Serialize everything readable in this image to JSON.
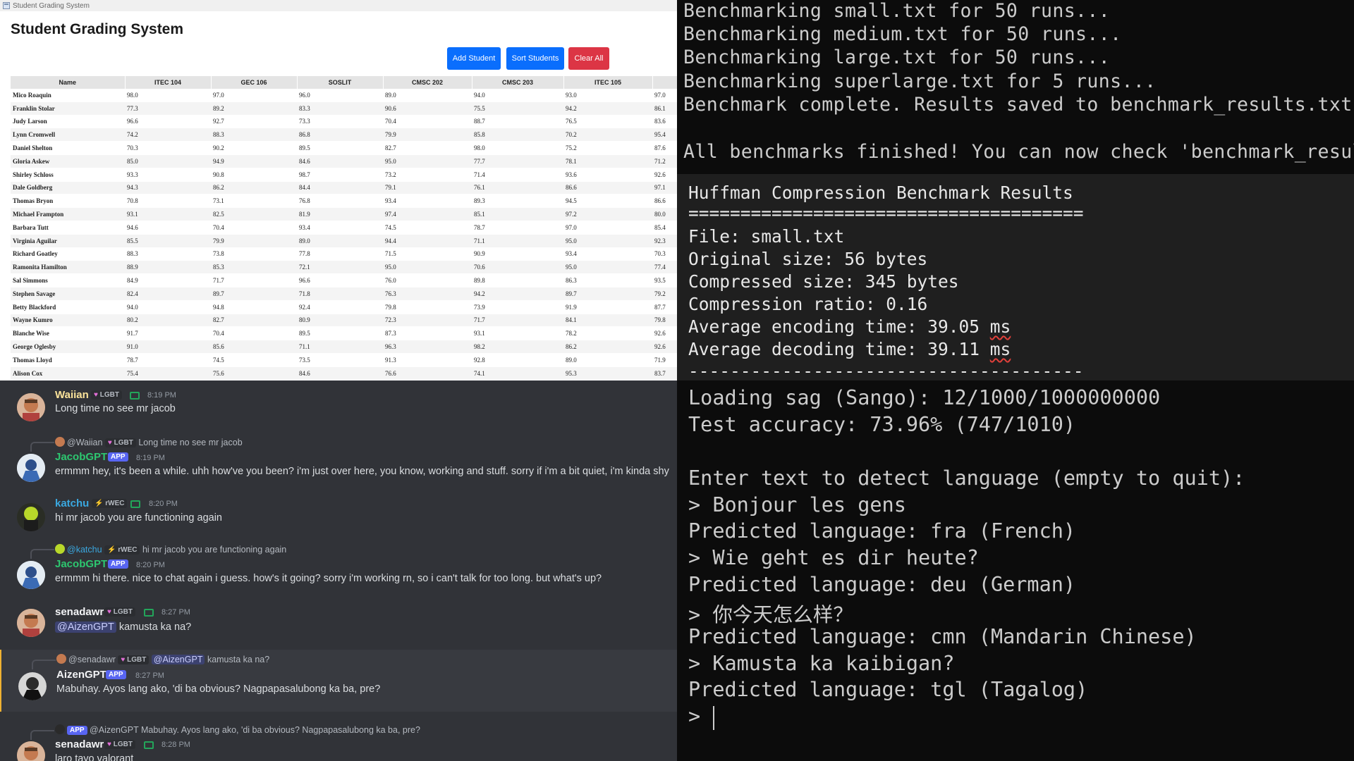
{
  "grading": {
    "window_title": "Student Grading System",
    "heading": "Student Grading System",
    "buttons": {
      "add": "Add Student",
      "sort": "Sort Students",
      "clear": "Clear All"
    },
    "columns": [
      "Name",
      "ITEC 104",
      "GEC 106",
      "SOSLIT",
      "CMSC 202",
      "CMSC 203",
      "ITEC 105",
      ""
    ],
    "rows": [
      [
        "Mico Roaquin",
        "98.0",
        "97.0",
        "96.0",
        "89.0",
        "94.0",
        "93.0",
        "97.0"
      ],
      [
        "Franklin Stolar",
        "77.3",
        "89.2",
        "83.3",
        "90.6",
        "75.5",
        "94.2",
        "86.1"
      ],
      [
        "Judy Larson",
        "96.6",
        "92.7",
        "73.3",
        "70.4",
        "88.7",
        "76.5",
        "83.6"
      ],
      [
        "Lynn Cromwell",
        "74.2",
        "88.3",
        "86.8",
        "79.9",
        "85.8",
        "70.2",
        "95.4"
      ],
      [
        "Daniel Shelton",
        "70.3",
        "90.2",
        "89.5",
        "82.7",
        "98.0",
        "75.2",
        "87.6"
      ],
      [
        "Gloria Askew",
        "85.0",
        "94.9",
        "84.6",
        "95.0",
        "77.7",
        "78.1",
        "71.2"
      ],
      [
        "Shirley Schloss",
        "93.3",
        "90.8",
        "98.7",
        "73.2",
        "71.4",
        "93.6",
        "92.6"
      ],
      [
        "Dale Goldberg",
        "94.3",
        "86.2",
        "84.4",
        "79.1",
        "76.1",
        "86.6",
        "97.1"
      ],
      [
        "Thomas Bryon",
        "70.8",
        "73.1",
        "76.8",
        "93.4",
        "89.3",
        "94.5",
        "86.6"
      ],
      [
        "Michael Frampton",
        "93.1",
        "82.5",
        "81.9",
        "97.4",
        "85.1",
        "97.2",
        "80.0"
      ],
      [
        "Barbara Tutt",
        "94.6",
        "70.4",
        "93.4",
        "74.5",
        "78.7",
        "97.0",
        "85.4"
      ],
      [
        "Virginia Aguilar",
        "85.5",
        "79.9",
        "89.0",
        "94.4",
        "71.1",
        "95.0",
        "92.3"
      ],
      [
        "Richard Goatley",
        "88.3",
        "73.8",
        "77.8",
        "71.5",
        "90.9",
        "93.4",
        "70.3"
      ],
      [
        "Ramonita Hamilton",
        "88.9",
        "85.3",
        "72.1",
        "95.0",
        "70.6",
        "95.0",
        "77.4"
      ],
      [
        "Sal Simmons",
        "84.9",
        "71.7",
        "96.6",
        "76.0",
        "89.8",
        "86.3",
        "93.5"
      ],
      [
        "Stephen Savage",
        "82.4",
        "89.7",
        "71.8",
        "76.3",
        "94.2",
        "89.7",
        "79.2"
      ],
      [
        "Betty Blackford",
        "94.0",
        "94.8",
        "92.4",
        "79.8",
        "73.9",
        "91.9",
        "87.7"
      ],
      [
        "Wayne Kumro",
        "80.2",
        "82.7",
        "80.9",
        "72.3",
        "71.7",
        "84.1",
        "79.8"
      ],
      [
        "Blanche Wise",
        "91.7",
        "70.4",
        "89.5",
        "87.3",
        "93.1",
        "78.2",
        "92.6"
      ],
      [
        "George Oglesby",
        "91.0",
        "85.6",
        "71.1",
        "96.3",
        "98.2",
        "86.2",
        "92.6"
      ],
      [
        "Thomas Lloyd",
        "78.7",
        "74.5",
        "73.5",
        "91.3",
        "92.8",
        "89.0",
        "71.9"
      ],
      [
        "Alison Cox",
        "75.4",
        "75.6",
        "84.6",
        "76.6",
        "74.1",
        "95.3",
        "83.7"
      ]
    ]
  },
  "terminal_top": {
    "lines": [
      "Benchmarking small.txt for 50 runs...",
      "Benchmarking medium.txt for 50 runs...",
      "Benchmarking large.txt for 50 runs...",
      "Benchmarking superlarge.txt for 5 runs...",
      "Benchmark complete. Results saved to benchmark_results.txt",
      "All benchmarks finished! You can now check 'benchmark_result"
    ]
  },
  "benchmark": {
    "title": "Huffman Compression Benchmark Results",
    "rule": "======================================",
    "file": "File: small.txt",
    "original": "Original size: 56 bytes",
    "compressed": "Compressed size: 345 bytes",
    "ratio": "Compression ratio: 0.16",
    "enc_prefix": "Average encoding time: 39.05 ",
    "dec_prefix": "Average decoding time: 39.11 ",
    "unit": "ms",
    "dash": "--------------------------------------"
  },
  "chat": {
    "messages": [
      {
        "user": "Waiian",
        "tag": "LGBT",
        "time": "8:19 PM",
        "text": "Long time no see mr jacob"
      },
      {
        "reply_user": "@Waiian",
        "reply_tag": "LGBT",
        "reply_text": "Long time no see mr jacob",
        "user": "JacobGPT",
        "app": "APP",
        "time": "8:19 PM",
        "text": "ermmm hey, it's been a while. uhh how've you been? i'm just over here, you know, working and stuff. sorry if i'm a bit quiet, i'm kinda shy"
      },
      {
        "user": "katchu",
        "tag": "rWEC",
        "time": "8:20 PM",
        "text": "hi mr jacob you are functioning again"
      },
      {
        "reply_user": "@katchu",
        "reply_tag": "rWEC",
        "reply_text": "hi mr jacob you are functioning again",
        "user": "JacobGPT",
        "app": "APP",
        "time": "8:20 PM",
        "text": "ermmm hi there. nice to chat again i guess. how's it going? sorry i'm working rn, so i can't talk for too long. but what's up?"
      },
      {
        "user": "senadawr",
        "tag": "LGBT",
        "time": "8:27 PM",
        "mention": "@AizenGPT",
        "text": "kamusta ka na?"
      },
      {
        "reply_user": "@senadawr",
        "reply_tag": "LGBT",
        "reply_mention": "@AizenGPT",
        "reply_text": "kamusta ka na?",
        "user": "AizenGPT",
        "app": "APP",
        "time": "8:27 PM",
        "text": "Mabuhay. Ayos lang ako, 'di ba obvious? Nagpapasalubong ka ba, pre?"
      },
      {
        "reply_app": "APP",
        "reply_user": "@AizenGPT",
        "reply_text": "Mabuhay. Ayos lang ako, 'di ba obvious? Nagpapasalubong ka ba, pre?",
        "user": "senadawr",
        "tag": "LGBT",
        "time": "8:28 PM",
        "text": "laro tayo valorant"
      }
    ]
  },
  "terminal_bottom": {
    "lines": [
      "Loading sag (Sango): 12/1000/1000000000",
      "Test accuracy: 73.96% (747/1010)",
      "",
      "Enter text to detect language (empty to quit):",
      "> Bonjour les gens",
      "Predicted language: fra (French)",
      "> Wie geht es dir heute?",
      "Predicted language: deu (German)",
      "> 你今天怎么样？",
      "Predicted language: cmn (Mandarin Chinese)",
      "> Kamusta ka kaibigan?",
      "Predicted language: tgl (Tagalog)",
      ">"
    ]
  },
  "colors": {
    "primary_button": "#0a6efd",
    "danger_button": "#dc3545",
    "jacob": "#2dc770",
    "katchu": "#3aa8e0",
    "waiian": "#fbe39a"
  }
}
